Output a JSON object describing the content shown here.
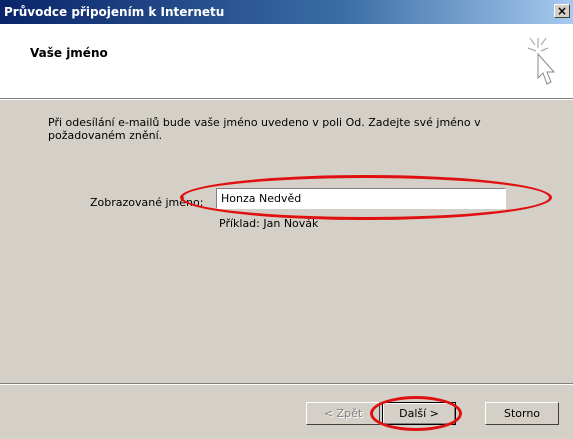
{
  "window": {
    "title": "Průvodce připojením k Internetu",
    "close_glyph": "×"
  },
  "header": {
    "title": "Vaše jméno",
    "icon": "wizard-cursor-icon"
  },
  "content": {
    "description": "Při odesílání e-mailů bude vaše jméno uvedeno v poli Od. Zadejte své jméno v požadovaném znění.",
    "field_label": "Zobrazované jméno:",
    "field_value": "Honza Nedvěd",
    "example": "Příklad: Jan Novák"
  },
  "buttons": {
    "back": "< Zpět",
    "next": "Další >",
    "cancel": "Storno"
  },
  "annotation_color": "#e01010"
}
